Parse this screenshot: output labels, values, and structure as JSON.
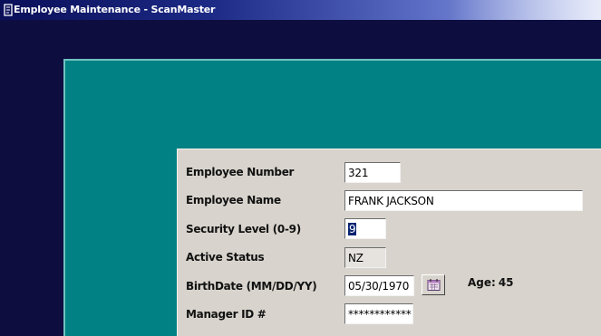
{
  "window": {
    "title": "Employee Maintenance - ScanMaster",
    "icon": "app-icon"
  },
  "colors": {
    "workspace": "#0d0d40",
    "mdi_background": "#018183",
    "form_background": "#d8d4cd",
    "selection": "#0a2472"
  },
  "form": {
    "employee_number": {
      "label": "Employee Number",
      "value": "321"
    },
    "employee_name": {
      "label": "Employee Name",
      "value": "FRANK JACKSON"
    },
    "security_level": {
      "label": "Security Level (0-9)",
      "value": "9"
    },
    "active_status": {
      "label": "Active Status",
      "value": "NZ"
    },
    "birth_date": {
      "label": "BirthDate (MM/DD/YY)",
      "value": "05/30/1970",
      "calendar_icon": "calendar-icon"
    },
    "age": {
      "label": "Age:",
      "value": "45"
    },
    "manager_id": {
      "label": "Manager ID #",
      "value": "************"
    }
  }
}
